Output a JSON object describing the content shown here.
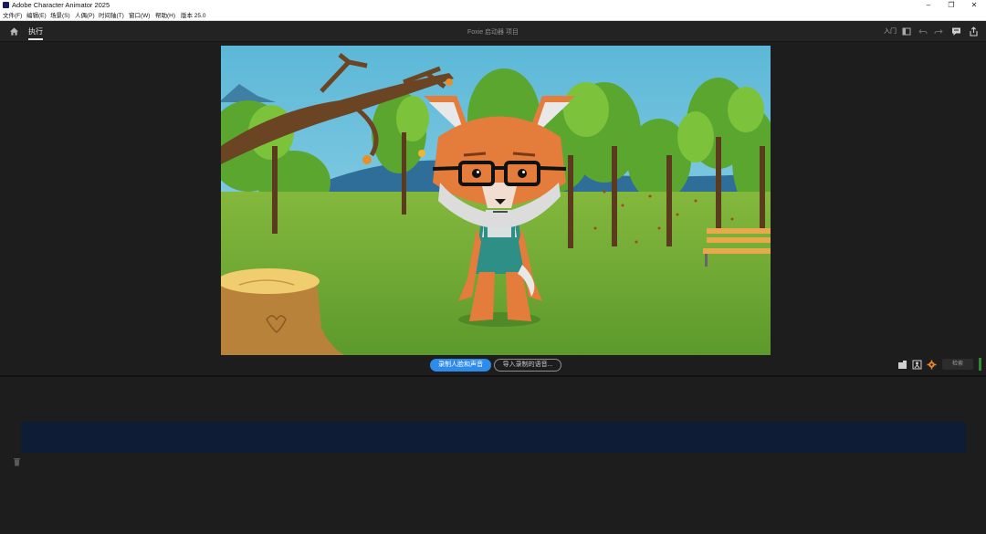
{
  "window": {
    "title": "Adobe Character Animator 2025",
    "minimize_glyph": "–",
    "restore_glyph": "❐",
    "close_glyph": "✕"
  },
  "menu": [
    "文件(F)",
    "编辑(E)",
    "场景(S)",
    "人偶(P)",
    "时间轴(T)",
    "窗口(W)",
    "帮助(H)",
    "版本 25.0"
  ],
  "header": {
    "tab": "执行",
    "project_title": "Foxie 启动器 项目",
    "intro_label": "入门"
  },
  "scene_controls": {
    "record_label": "录制人脸和声音",
    "import_label": "导入录制的语音...",
    "zoom_label": "检索"
  },
  "colors": {
    "accent": "#2d8ceb",
    "timeline_track": "#0e1d35",
    "status_green": "#2f8a33"
  },
  "icons": [
    "home-icon",
    "layout-icon",
    "undo-icon",
    "redo-icon",
    "comment-icon",
    "share-icon",
    "camera-icon",
    "puppet-icon",
    "settings-icon",
    "trash-icon"
  ]
}
